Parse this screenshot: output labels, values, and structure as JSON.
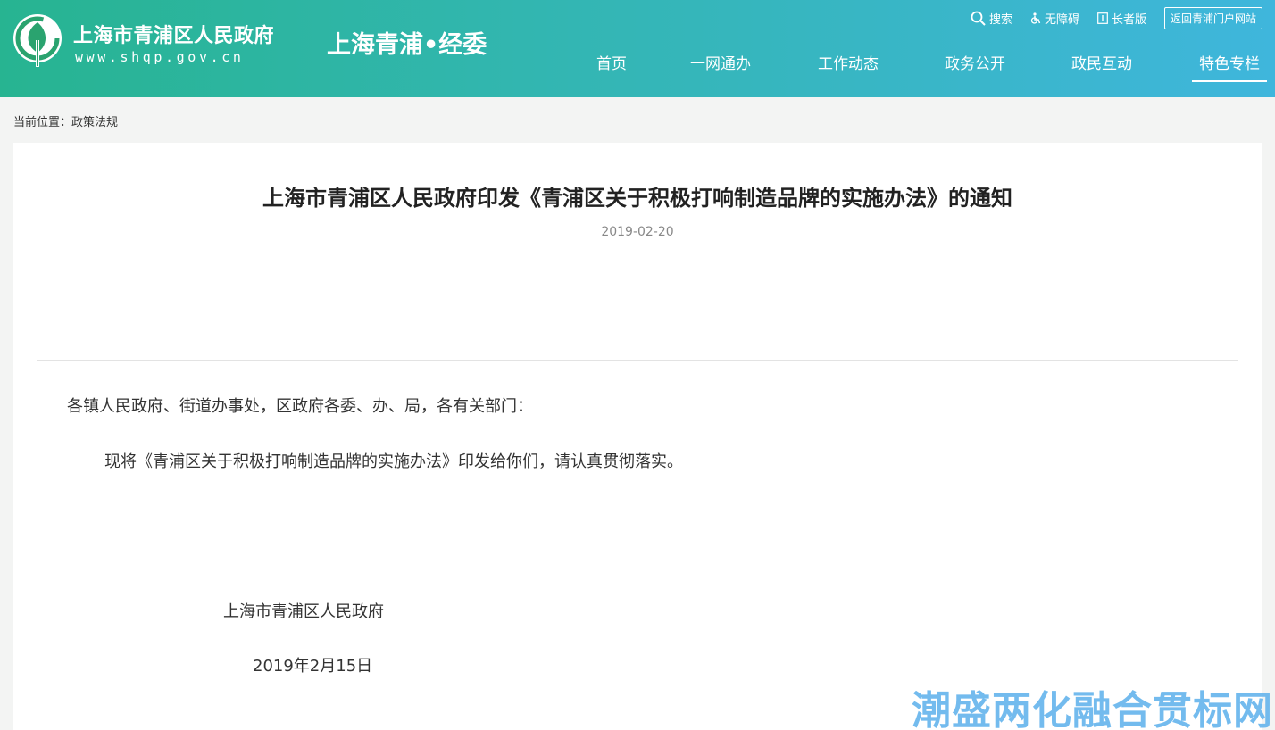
{
  "header": {
    "site_name": "上海市青浦区人民政府",
    "site_url": "www.shqp.gov.cn",
    "sub_name": "上海青浦•经委",
    "tools": {
      "search": "搜索",
      "accessibility": "无障碍",
      "elder": "长者版",
      "return_portal": "返回青浦门户网站"
    },
    "nav": [
      {
        "label": "首页"
      },
      {
        "label": "一网通办"
      },
      {
        "label": "工作动态"
      },
      {
        "label": "政务公开"
      },
      {
        "label": "政民互动"
      },
      {
        "label": "特色专栏"
      }
    ],
    "colors": {
      "gradient_start": "#27b491",
      "gradient_end": "#3fb6dc",
      "logo_green": "#2aa36f"
    }
  },
  "breadcrumb": "当前位置：政策法规",
  "article": {
    "title": "上海市青浦区人民政府印发《青浦区关于积极打响制造品牌的实施办法》的通知",
    "date": "2019-02-20",
    "salutation": "各镇人民政府、街道办事处，区政府各委、办、局，各有关部门：",
    "body": "现将《青浦区关于积极打响制造品牌的实施办法》印发给你们，请认真贯彻落实。",
    "signature": "上海市青浦区人民政府",
    "signature_date": "2019年2月15日"
  },
  "watermark": "潮盛两化融合贯标网"
}
